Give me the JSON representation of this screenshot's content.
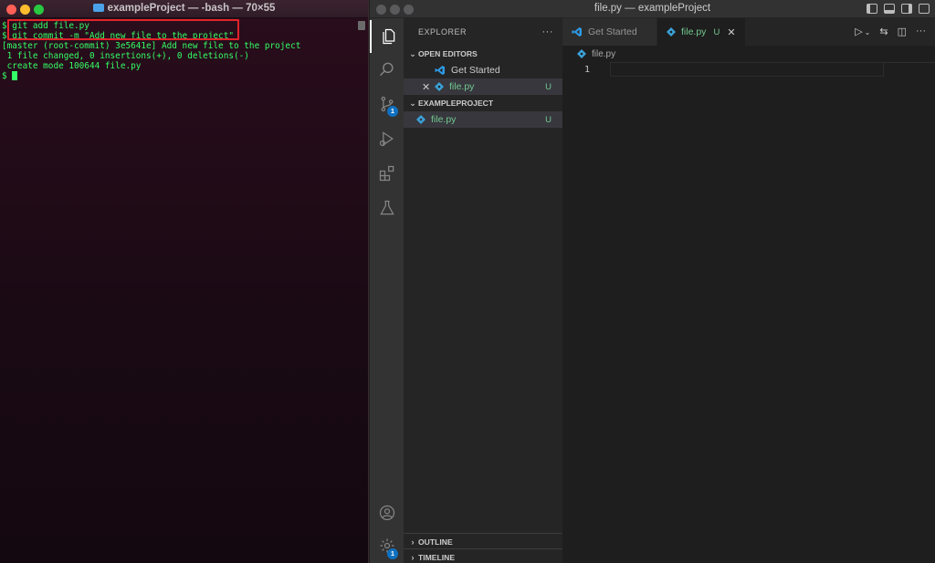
{
  "terminal": {
    "title": "exampleProject — -bash — 70×55",
    "lines": [
      "$ git add file.py",
      "$ git commit -m \"Add new file to the project\"",
      "[master (root-commit) 3e5641e] Add new file to the project",
      " 1 file changed, 0 insertions(+), 0 deletions(-)",
      " create mode 100644 file.py",
      "$ "
    ]
  },
  "vscode": {
    "title": "file.py — exampleProject",
    "activity": {
      "scm_badge": "1",
      "settings_badge": "1"
    },
    "sidebar": {
      "header": "EXPLORER",
      "more": "···",
      "open_editors_label": "OPEN EDITORS",
      "open_editors": [
        {
          "label": "Get Started"
        },
        {
          "label": "file.py",
          "status": "U"
        }
      ],
      "project_label": "EXAMPLEPROJECT",
      "files": [
        {
          "label": "file.py",
          "status": "U"
        }
      ],
      "outline_label": "OUTLINE",
      "timeline_label": "TIMELINE"
    },
    "tabs": [
      {
        "label": "Get Started"
      },
      {
        "label": "file.py",
        "status": "U"
      }
    ],
    "breadcrumb": "file.py",
    "editor": {
      "line_numbers": [
        "1"
      ]
    }
  },
  "colors": {
    "terminal_text": "#33ff66",
    "highlight": "#e0242a",
    "untracked": "#73c991",
    "badge": "#0e70c0"
  }
}
